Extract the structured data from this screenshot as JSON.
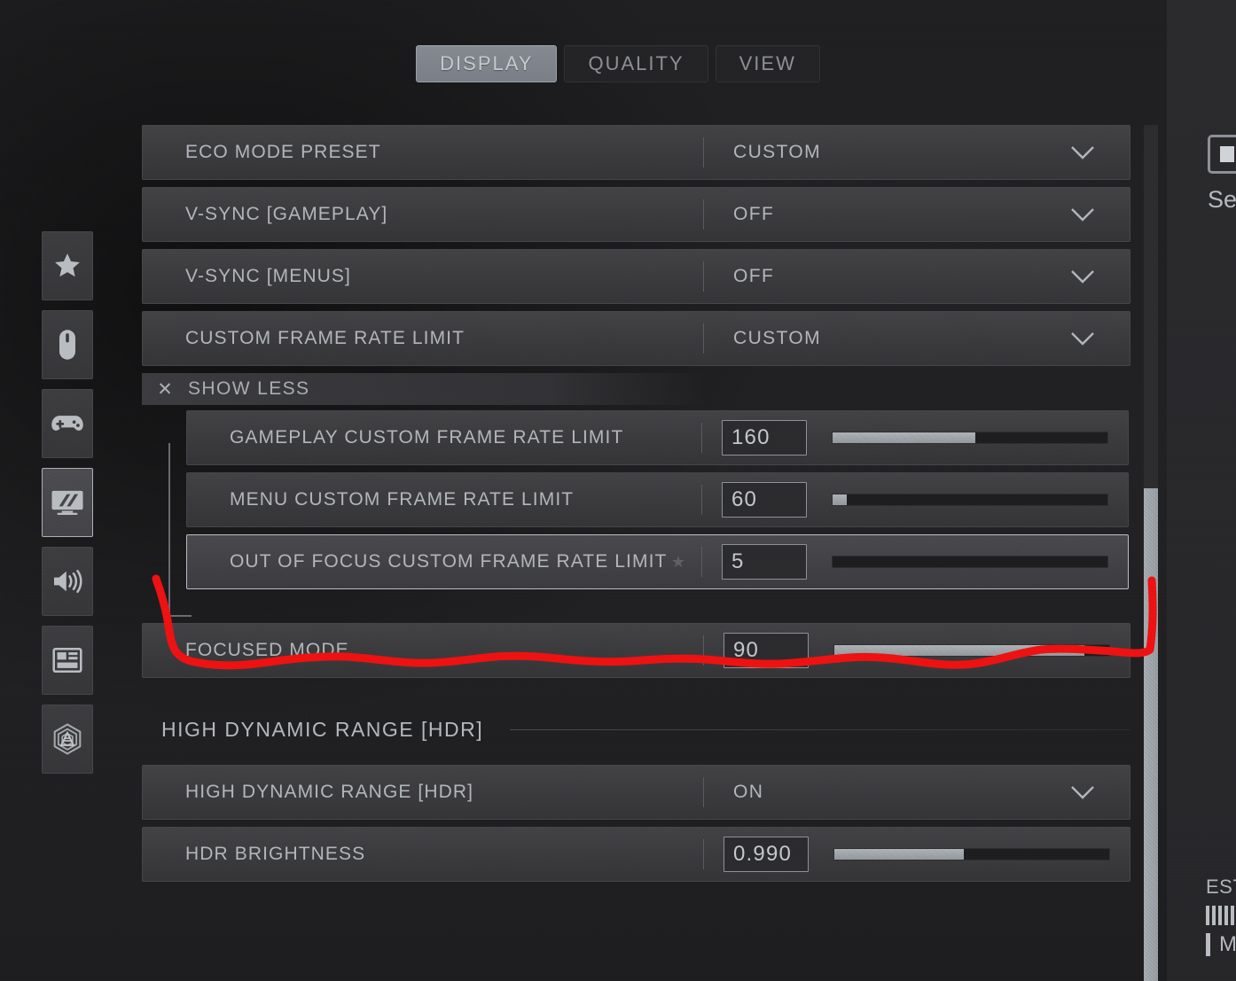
{
  "tabs": [
    {
      "label": "DISPLAY",
      "active": true
    },
    {
      "label": "QUALITY",
      "active": false
    },
    {
      "label": "VIEW",
      "active": false
    }
  ],
  "sidebar": {
    "items": [
      {
        "name": "favorites",
        "icon": "star-icon",
        "selected": false
      },
      {
        "name": "mouse-keyboard",
        "icon": "mouse-icon",
        "selected": false
      },
      {
        "name": "controller",
        "icon": "gamepad-icon",
        "selected": false
      },
      {
        "name": "graphics",
        "icon": "monitor-icon",
        "selected": true
      },
      {
        "name": "audio",
        "icon": "speaker-icon",
        "selected": false
      },
      {
        "name": "interface",
        "icon": "hud-layout-icon",
        "selected": false
      },
      {
        "name": "telemetry",
        "icon": "broadcast-icon",
        "selected": false
      }
    ]
  },
  "settings": {
    "rows": [
      {
        "id": "eco-mode-preset",
        "label": "ECO MODE PRESET",
        "type": "dropdown",
        "value": "CUSTOM"
      },
      {
        "id": "v-sync-gameplay",
        "label": "V-SYNC [GAMEPLAY]",
        "type": "dropdown",
        "value": "OFF"
      },
      {
        "id": "v-sync-menus",
        "label": "V-SYNC [MENUS]",
        "type": "dropdown",
        "value": "OFF"
      },
      {
        "id": "custom-frame-rate-limit",
        "label": "CUSTOM FRAME RATE LIMIT",
        "type": "dropdown",
        "value": "CUSTOM"
      }
    ],
    "show_less": {
      "label": "SHOW LESS",
      "close_icon": "close-icon"
    },
    "children": [
      {
        "id": "gameplay-custom-frame-rate-limit",
        "label": "GAMEPLAY CUSTOM FRAME RATE LIMIT",
        "type": "slider",
        "value": "160",
        "fill_percent": 52,
        "starred": false,
        "highlighted": false
      },
      {
        "id": "menu-custom-frame-rate-limit",
        "label": "MENU CUSTOM FRAME RATE LIMIT",
        "type": "slider",
        "value": "60",
        "fill_percent": 5,
        "starred": false,
        "highlighted": false
      },
      {
        "id": "out-of-focus-custom-frame-rate-limit",
        "label": "OUT OF FOCUS CUSTOM FRAME RATE LIMIT",
        "type": "slider",
        "value": "5",
        "fill_percent": 0,
        "starred": true,
        "highlighted": true
      }
    ],
    "after_children": [
      {
        "id": "focused-mode",
        "label": "FOCUSED MODE",
        "type": "slider",
        "value": "90",
        "fill_percent": 91,
        "starred": false,
        "highlighted": false
      }
    ],
    "hdr_section": {
      "heading": "HIGH DYNAMIC RANGE [HDR]",
      "rows": [
        {
          "id": "high-dynamic-range-hdr",
          "label": "HIGH DYNAMIC RANGE [HDR]",
          "type": "dropdown",
          "value": "ON"
        },
        {
          "id": "hdr-brightness",
          "label": "HDR BRIGHTNESS",
          "type": "slider",
          "value": "0.990",
          "fill_percent": 47,
          "starred": false,
          "highlighted": false
        }
      ]
    }
  },
  "right_panel": {
    "icon": "stop-square-icon",
    "title_partial": "Set",
    "estimated_partial": "ESTI",
    "mode_partial": "MO"
  },
  "annotation": {
    "type": "freehand-highlight",
    "color": "#ee1111",
    "target": "out-of-focus-custom-frame-rate-limit"
  },
  "colors": {
    "background": "#1f1f21",
    "row": "#3a3a3d",
    "row_border": "#46464a",
    "text": "#b2b6ba",
    "accent_active_tab": "#7d828a",
    "slider_fill": "#a6abb1",
    "annotation_red": "#ee1111"
  }
}
